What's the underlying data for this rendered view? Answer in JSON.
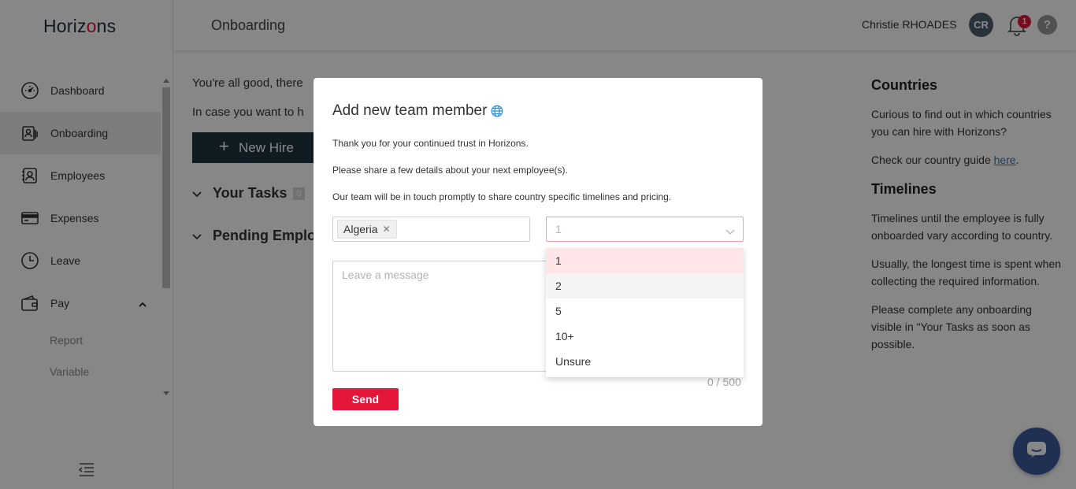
{
  "app": {
    "logo_text": "Horizons",
    "brand_color": "#e4163a",
    "dark_color": "#1f3340"
  },
  "sidebar": {
    "items": [
      {
        "label": "Dashboard",
        "icon": "speedometer-icon"
      },
      {
        "label": "Onboarding",
        "icon": "id-badge-icon",
        "active": true
      },
      {
        "label": "Employees",
        "icon": "employee-card-icon"
      },
      {
        "label": "Expenses",
        "icon": "credit-card-icon"
      },
      {
        "label": "Leave",
        "icon": "clock-icon"
      },
      {
        "label": "Pay",
        "icon": "wallet-icon",
        "expanded": true
      }
    ],
    "pay_subitems": [
      "Report",
      "Variable"
    ]
  },
  "header": {
    "title": "Onboarding",
    "user_name": "Christie RHOADES",
    "avatar_initials": "CR",
    "notification_count": "1",
    "help_label": "?"
  },
  "main": {
    "message_1": "You're all good, there",
    "message_2": "In case you want to h",
    "new_hire_label": "New Hire",
    "tasks_label": "Your Tasks",
    "tasks_count": "0",
    "pending_label": "Pending Emplo"
  },
  "info_panel": {
    "countries_title": "Countries",
    "countries_text": "Curious to find out in which countries you can hire with Horizons?",
    "guide_prefix": "Check our country guide ",
    "guide_link": "here",
    "guide_suffix": ".",
    "timelines_title": "Timelines",
    "timelines_p1": "Timelines until the employee is fully onboarded vary according to country.",
    "timelines_p2": "Usually, the longest time is spent when collecting the required information.",
    "timelines_p3": "Please complete any onboarding visible in \"Your Tasks as soon as possible."
  },
  "modal": {
    "title": "Add new team member",
    "line_1": "Thank you for your continued trust in Horizons.",
    "line_2": "Please share a few details about your next employee(s).",
    "line_3": "Our team will be in touch promptly to share country specific timelines and pricing.",
    "country_tag": "Algeria",
    "count_value": "1",
    "message_placeholder": "Leave a message",
    "char_count": "0 / 500",
    "send_label": "Send"
  },
  "dropdown": {
    "options": [
      "1",
      "2",
      "5",
      "10+",
      "Unsure"
    ],
    "selected": "1",
    "hovered": "2"
  }
}
